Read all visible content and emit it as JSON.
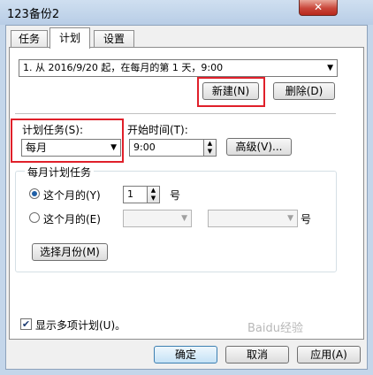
{
  "window": {
    "title": "123备份2",
    "close_icon": "close-icon"
  },
  "tabs": [
    {
      "label": "任务",
      "active": false
    },
    {
      "label": "计划",
      "active": true
    },
    {
      "label": "设置",
      "active": false
    }
  ],
  "schedule": {
    "selected": "1. 从 2016/9/20 起，在每月的第 1 天，9:00",
    "new_label": "新建(N)",
    "delete_label": "删除(D)"
  },
  "plan_task": {
    "label": "计划任务(S):",
    "value": "每月"
  },
  "start_time": {
    "label": "开始时间(T):",
    "value": "9:00"
  },
  "advanced_label": "高级(V)...",
  "monthly": {
    "title": "每月计划任务",
    "option1_label": "这个月的(Y)",
    "option1_value": "1",
    "option1_suffix": "号",
    "option2_label": "这个月的(E)",
    "option2_suffix": "号",
    "select_months_label": "选择月份(M)"
  },
  "show_multiple_label": "显示多项计划(U)。",
  "footer": {
    "ok_label": "确定",
    "cancel_label": "取消",
    "apply_label": "应用(A)"
  },
  "watermark": "Baidu经验",
  "colors": {
    "highlight": "#e0202a",
    "accent": "#1f5fa6"
  }
}
